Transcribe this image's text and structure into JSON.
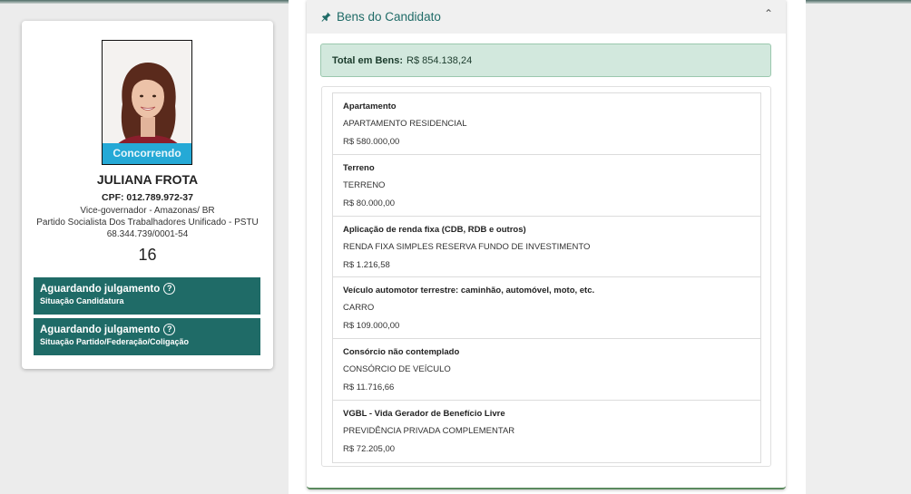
{
  "candidate": {
    "status": "Concorrendo",
    "name": "JULIANA FROTA",
    "cpf": "CPF: 012.789.972-37",
    "office": "Vice-governador - Amazonas/ BR",
    "party": "Partido Socialista Dos Trabalhadores Unificado - PSTU",
    "cnpj": "68.344.739/0001-54",
    "number": "16",
    "situations": [
      {
        "title": "Aguardando julgamento",
        "subtitle": "Situação Candidatura"
      },
      {
        "title": "Aguardando julgamento",
        "subtitle": "Situação Partido/Federação/Coligação"
      }
    ]
  },
  "assets": {
    "header_title": "Bens do Candidato",
    "total_label": "Total em Bens:",
    "total_value": "R$ 854.138,24",
    "items": [
      {
        "type": "Apartamento",
        "description": "APARTAMENTO RESIDENCIAL",
        "value": "R$ 580.000,00"
      },
      {
        "type": "Terreno",
        "description": "TERRENO",
        "value": "R$ 80.000,00"
      },
      {
        "type": "Aplicação de renda fixa (CDB, RDB e outros)",
        "description": "RENDA FIXA SIMPLES RESERVA FUNDO DE INVESTIMENTO",
        "value": "R$ 1.216,58"
      },
      {
        "type": "Veículo automotor terrestre: caminhão, automóvel, moto, etc.",
        "description": "CARRO",
        "value": "R$ 109.000,00"
      },
      {
        "type": "Consórcio não contemplado",
        "description": "CONSÓRCIO DE VEÍCULO",
        "value": "R$ 11.716,66"
      },
      {
        "type": "VGBL - Vida Gerador de Benefício Livre",
        "description": "PREVIDÊNCIA PRIVADA COMPLEMENTAR",
        "value": "R$ 72.205,00"
      }
    ]
  },
  "colors": {
    "accent": "#1f6b67",
    "status_ribbon": "#25a9d6",
    "total_bg": "#d2e8dd"
  },
  "icons": {
    "assets_header": "pushpin-icon",
    "collapse": "chevron-up-icon",
    "help": "question-circle-icon"
  }
}
